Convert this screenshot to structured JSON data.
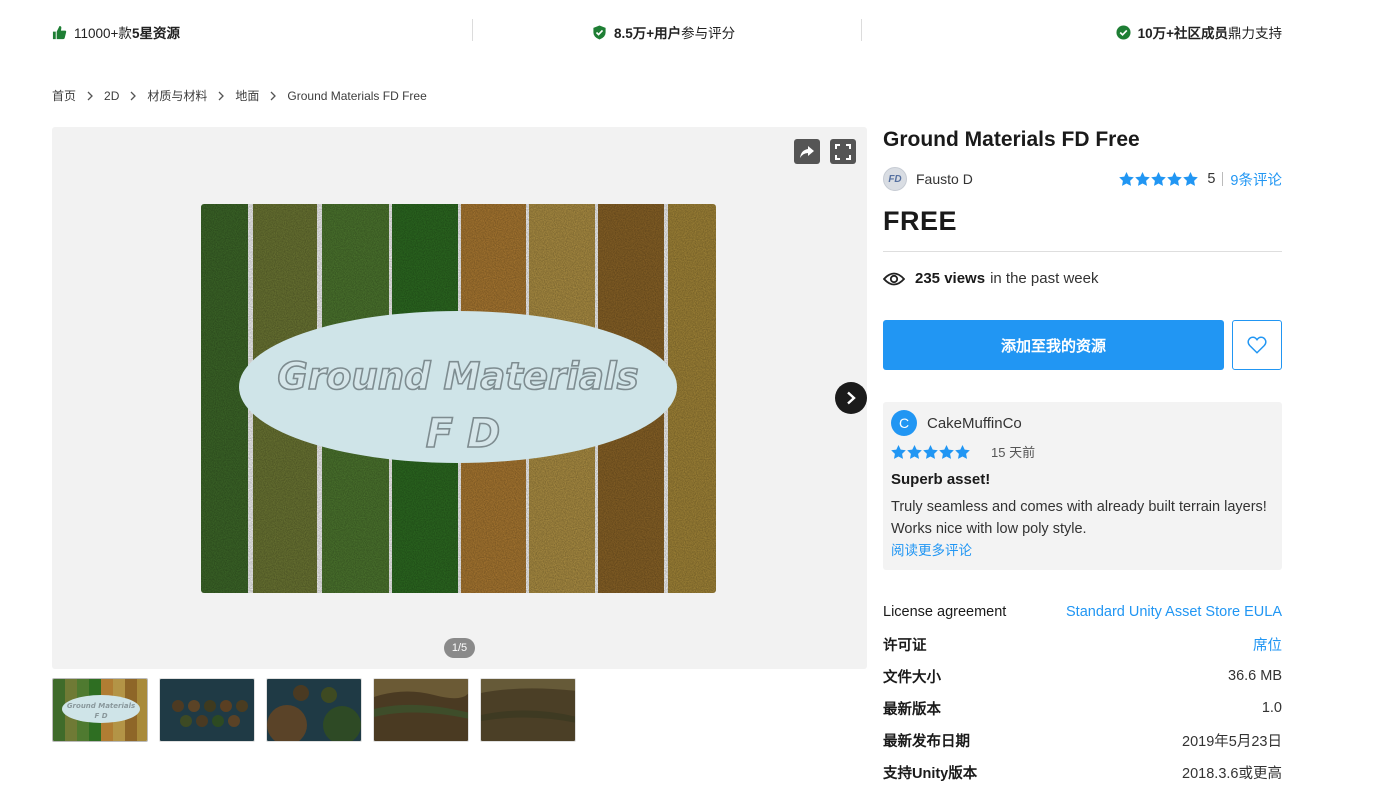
{
  "trust_bar": {
    "item1": {
      "prefix": "11000+款",
      "bold": "5星资源",
      "icon": "thumbs-up-icon"
    },
    "item2": {
      "bold": "8.5万+用户",
      "suffix": "参与评分",
      "icon": "shield-check-icon"
    },
    "item3": {
      "bold": "10万+社区成员",
      "suffix": "鼎力支持",
      "icon": "check-circle-icon"
    },
    "accent": "#1e7e34"
  },
  "breadcrumb": [
    "首页",
    "2D",
    "材质与材料",
    "地面",
    "Ground Materials FD Free"
  ],
  "gallery": {
    "pager": "1/5",
    "hero_title_line1": "Ground Materials",
    "hero_title_line2": "F D",
    "thumb1_line1": "Ground Materials",
    "thumb1_line2": "F D"
  },
  "product": {
    "title": "Ground Materials FD Free",
    "publisher": "Fausto D",
    "publisher_initials": "FD",
    "rating": "5",
    "reviews_link": "9条评论",
    "price": "FREE",
    "views_count": "235 views",
    "views_suffix": "in the past week",
    "cta_label": "添加至我的资源"
  },
  "review": {
    "avatar_letter": "C",
    "user": "CakeMuffinCo",
    "date": "15 天前",
    "title": "Superb asset!",
    "body": "Truly seamless and comes with already built terrain layers! Works nice with low poly style.",
    "more_link": "阅读更多评论"
  },
  "specs": [
    {
      "key": "License agreement",
      "value": "Standard Unity Asset Store EULA",
      "key_bold": false,
      "link": true
    },
    {
      "key": "许可证",
      "value": "席位",
      "key_bold": true,
      "link": true
    },
    {
      "key": "文件大小",
      "value": "36.6 MB",
      "key_bold": true,
      "link": false
    },
    {
      "key": "最新版本",
      "value": "1.0",
      "key_bold": true,
      "link": false
    },
    {
      "key": "最新发布日期",
      "value": "2019年5月23日",
      "key_bold": true,
      "link": false
    },
    {
      "key": "支持Unity版本",
      "value": "2018.3.6或更高",
      "key_bold": true,
      "link": false
    }
  ],
  "colors": {
    "accent_blue": "#2196f3",
    "star": "#2196f3"
  }
}
